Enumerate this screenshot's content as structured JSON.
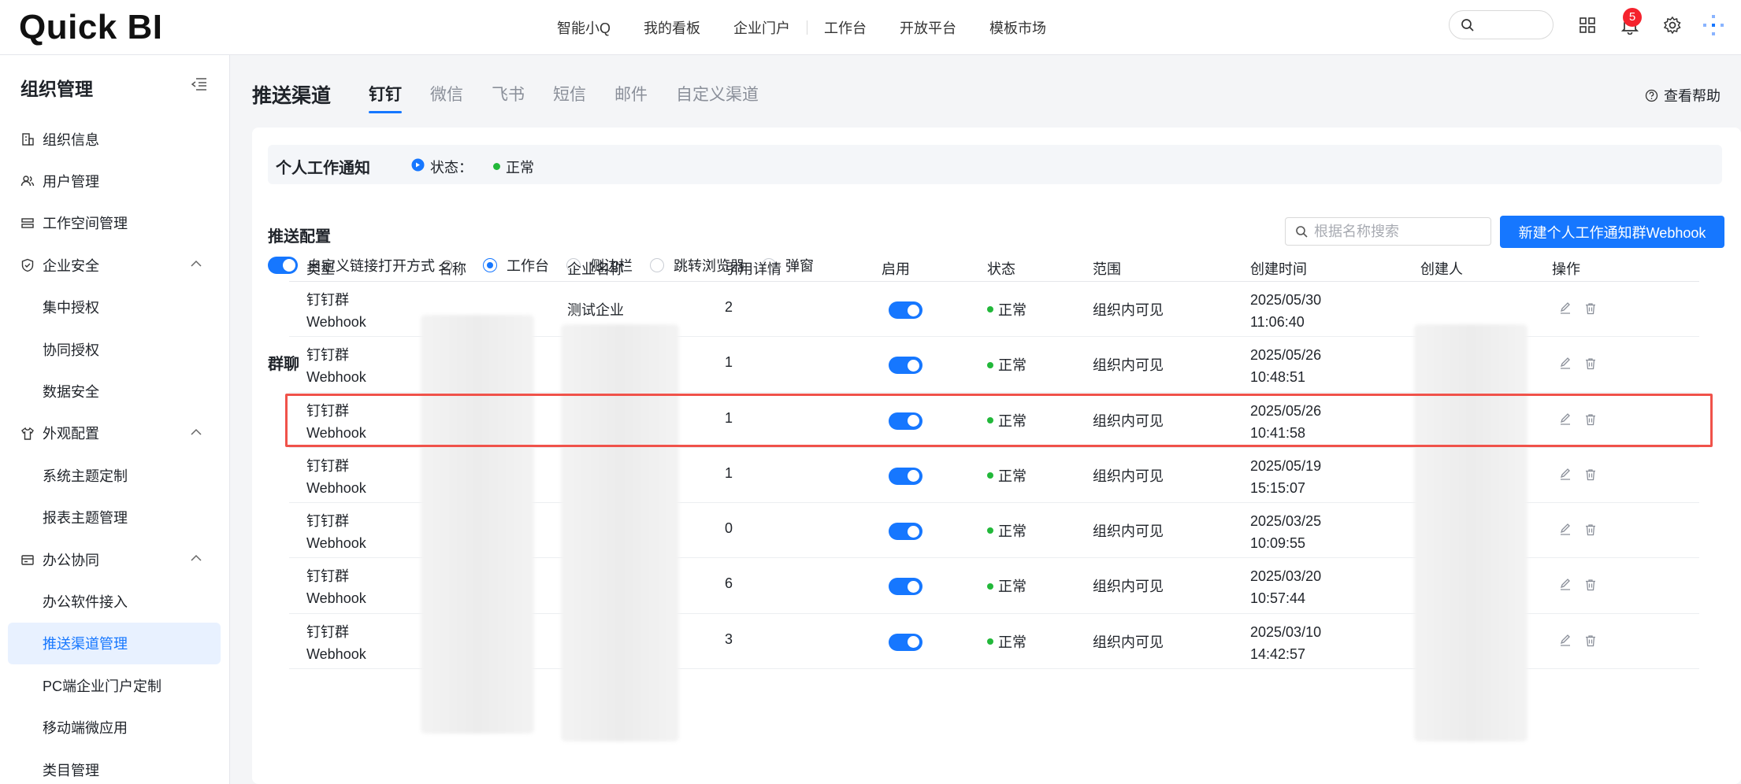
{
  "topbar": {
    "logo": "Quick BI",
    "nav": [
      "智能小Q",
      "我的看板",
      "企业门户",
      "工作台",
      "开放平台",
      "模板市场"
    ],
    "notification_count": "5",
    "brand_color": "#1677ff"
  },
  "sidebar": {
    "title": "组织管理",
    "items": [
      {
        "label": "组织信息",
        "icon": "building-icon"
      },
      {
        "label": "用户管理",
        "icon": "users-icon"
      },
      {
        "label": "工作空间管理",
        "icon": "workspace-icon"
      },
      {
        "label": "企业安全",
        "icon": "shield-icon",
        "expanded": true,
        "children": [
          "集中授权",
          "协同授权",
          "数据安全"
        ]
      },
      {
        "label": "外观配置",
        "icon": "shirt-icon",
        "expanded": true,
        "children": [
          "系统主题定制",
          "报表主题管理"
        ]
      },
      {
        "label": "办公协同",
        "icon": "office-icon",
        "expanded": true,
        "children": [
          "办公软件接入",
          "推送渠道管理",
          "PC端企业门户定制",
          "移动端微应用",
          "类目管理"
        ]
      }
    ],
    "active_item": "推送渠道管理"
  },
  "page": {
    "title": "推送渠道",
    "tabs": [
      "钉钉",
      "微信",
      "飞书",
      "短信",
      "邮件",
      "自定义渠道"
    ],
    "active_tab": "钉钉",
    "help": "查看帮助"
  },
  "notice": {
    "title": "个人工作通知",
    "status_label": "状态：",
    "status_value": "正常"
  },
  "push_config": {
    "title": "推送配置",
    "toggle_label": "自定义链接打开方式",
    "toggle_on": true,
    "options": [
      "工作台",
      "侧边栏",
      "跳转浏览器",
      "弹窗"
    ],
    "selected": "工作台"
  },
  "group": {
    "title": "群聊",
    "search_placeholder": "根据名称搜索",
    "new_button": "新建个人工作通知群Webhook"
  },
  "table": {
    "headers": [
      "类型",
      "名称",
      "企业名称",
      "引用详情",
      "启用",
      "状态",
      "范围",
      "创建时间",
      "创建人",
      "操作"
    ],
    "rows": [
      {
        "type1": "钉钉群",
        "type2": "Webhook",
        "company": "测试企业",
        "ref": "2",
        "enabled": true,
        "status": "正常",
        "scope": "组织内可见",
        "date": "2025/05/30",
        "time": "11:06:40",
        "highlighted": true
      },
      {
        "type1": "钉钉群",
        "type2": "Webhook",
        "company": "",
        "ref": "1",
        "enabled": true,
        "status": "正常",
        "scope": "组织内可见",
        "date": "2025/05/26",
        "time": "10:48:51"
      },
      {
        "type1": "钉钉群",
        "type2": "Webhook",
        "company": "",
        "ref": "1",
        "enabled": true,
        "status": "正常",
        "scope": "组织内可见",
        "date": "2025/05/26",
        "time": "10:41:58"
      },
      {
        "type1": "钉钉群",
        "type2": "Webhook",
        "company": "",
        "ref": "1",
        "enabled": true,
        "status": "正常",
        "scope": "组织内可见",
        "date": "2025/05/19",
        "time": "15:15:07"
      },
      {
        "type1": "钉钉群",
        "type2": "Webhook",
        "company": "",
        "ref": "0",
        "enabled": true,
        "status": "正常",
        "scope": "组织内可见",
        "date": "2025/03/25",
        "time": "10:09:55"
      },
      {
        "type1": "钉钉群",
        "type2": "Webhook",
        "company": "",
        "ref": "6",
        "enabled": true,
        "status": "正常",
        "scope": "组织内可见",
        "date": "2025/03/20",
        "time": "10:57:44"
      },
      {
        "type1": "钉钉群",
        "type2": "Webhook",
        "company": "",
        "ref": "3",
        "enabled": true,
        "status": "正常",
        "scope": "组织内可见",
        "date": "2025/03/10",
        "time": "14:42:57"
      }
    ]
  }
}
